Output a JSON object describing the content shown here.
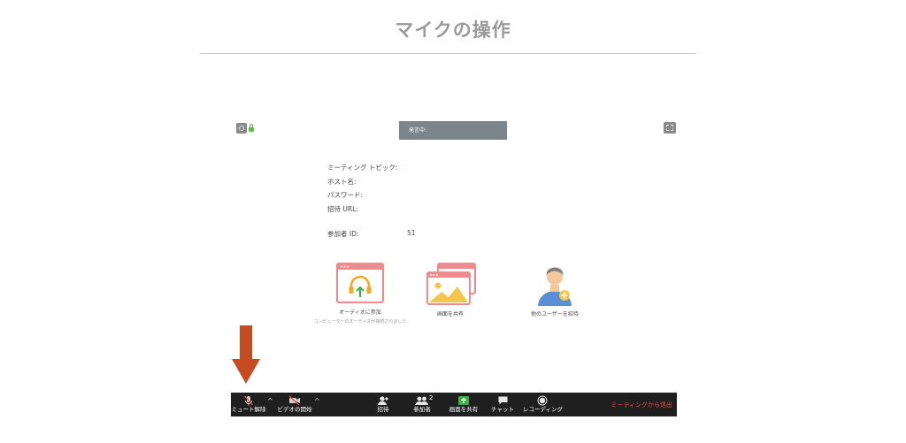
{
  "page": {
    "title": "マイクの操作"
  },
  "meeting": {
    "speaking_label": "発言中:",
    "info": {
      "topic_label": "ミーティング トピック:",
      "host_label": "ホスト名:",
      "password_label": "パスワード:",
      "invite_url_label": "招待 URL:",
      "participant_id_label": "参加者 ID:",
      "participant_id_value": "51"
    },
    "tiles": {
      "audio_label": "オーディオに参加",
      "audio_sublabel": "コンピューターのオーディオが接続されました",
      "share_label": "画面を共有",
      "invite_label": "他のユーザーを招待"
    },
    "toolbar": {
      "unmute": "ミュート解除",
      "start_video": "ビデオの開始",
      "invite": "招待",
      "participants": "参加者",
      "participants_count": "2",
      "share_screen": "画面を共有",
      "chat": "チャット",
      "recording": "レコーディング",
      "leave": "ミーティングから退出"
    }
  },
  "colors": {
    "toolbar_bg": "#1f1f1f",
    "leave_text": "#e24a3c",
    "share_green": "#3cb043",
    "arrow": "#c64a22",
    "tile_pink": "#ef8a8f"
  },
  "icons": [
    "info-icon",
    "lock-icon",
    "fullscreen-icon",
    "headphones-icon",
    "share-screen-icon",
    "add-user-icon",
    "mic-muted-icon",
    "video-off-icon",
    "chevron-up-icon",
    "invite-icon",
    "participants-icon",
    "share-arrow-icon",
    "chat-icon",
    "record-icon",
    "down-arrow-icon"
  ]
}
